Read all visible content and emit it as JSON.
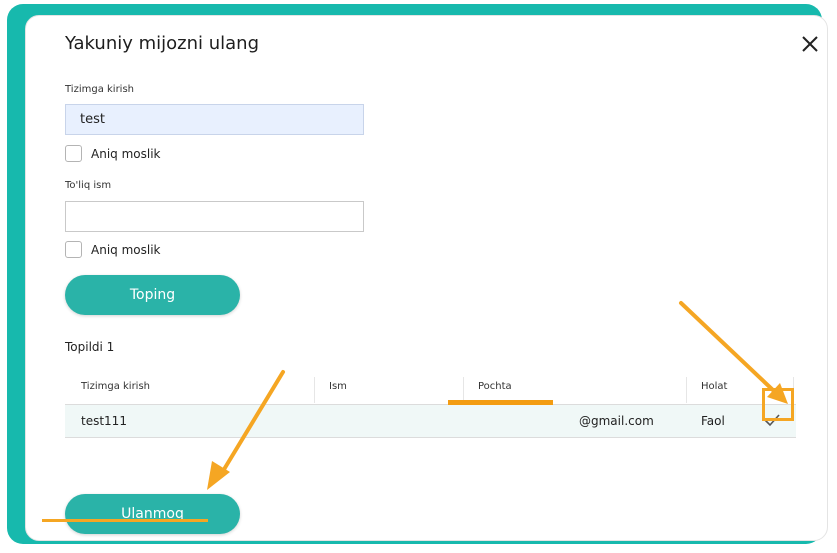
{
  "dialog": {
    "title": "Yakuniy mijozni ulang",
    "close_icon": "close-icon"
  },
  "form": {
    "login_label": "Tizimga kirish",
    "login_value": "test",
    "exact_match_label": "Aniq moslik",
    "fullname_label": "To'liq ism",
    "fullname_value": "",
    "exact_match_label_2": "Aniq moslik",
    "search_button": "Toping"
  },
  "results": {
    "found_label": "Topildi 1",
    "columns": [
      "Tizimga kirish",
      "Ism",
      "Pochta",
      "Holat"
    ],
    "rows": [
      {
        "login": "test111",
        "name": "",
        "email": "@gmail.com",
        "status": "Faol"
      }
    ]
  },
  "actions": {
    "connect_button": "Ulanmoq"
  },
  "colors": {
    "teal": "#2ab3a8",
    "annotation": "#f5a623"
  }
}
